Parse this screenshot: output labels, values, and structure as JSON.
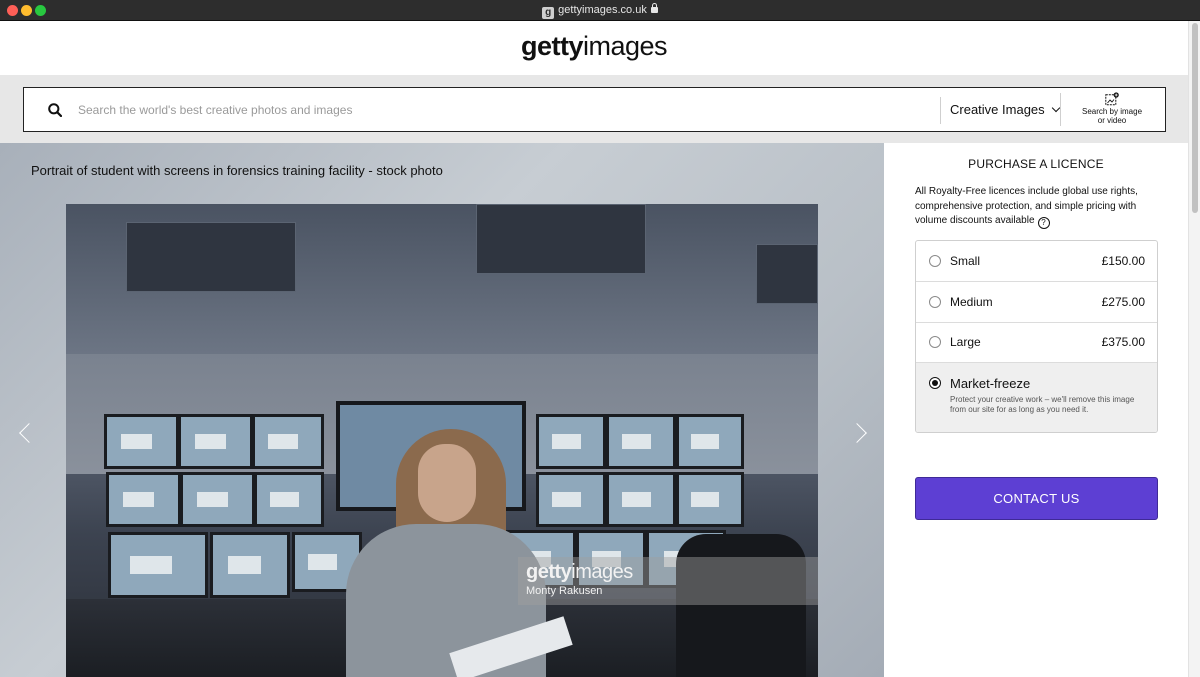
{
  "browser": {
    "url": "gettyimages.co.uk",
    "favicon_letter": "g",
    "lock_icon": "lock-icon"
  },
  "header": {
    "logo_bold": "getty",
    "logo_light": "images"
  },
  "search": {
    "placeholder": "Search the world's best creative photos and images",
    "value": "",
    "type_selected": "Creative Images",
    "search_by_image_line1": "Search by image",
    "search_by_image_line2": "or video"
  },
  "image": {
    "title": "Portrait of student with screens in forensics training facility - stock photo",
    "watermark_logo_bold": "getty",
    "watermark_logo_light": "images",
    "credit": "Monty Rakusen"
  },
  "purchase": {
    "title": "PURCHASE A LICENCE",
    "description": "All Royalty-Free licences include global use rights, comprehensive protection, and simple pricing with volume discounts available",
    "options": [
      {
        "label": "Small",
        "price": "£150.00",
        "selected": false
      },
      {
        "label": "Medium",
        "price": "£275.00",
        "selected": false
      },
      {
        "label": "Large",
        "price": "£375.00",
        "selected": false
      }
    ],
    "market_freeze": {
      "label": "Market-freeze",
      "description": "Protect your creative work – we'll remove this image from our site for as long as you need it.",
      "selected": true
    },
    "contact_label": "CONTACT US"
  },
  "colors": {
    "accent": "#5d3fd3",
    "page_bg": "#ffffff",
    "search_band": "#e7e7e7"
  }
}
